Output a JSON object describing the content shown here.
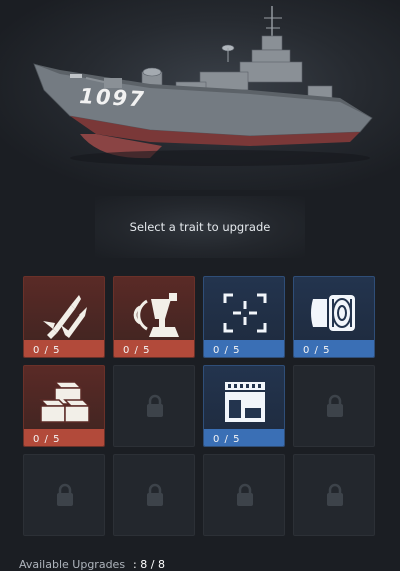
{
  "ship": {
    "hull_number": "1097"
  },
  "prompt": "Select a trait to upgrade",
  "traits": [
    {
      "name": "missile-upgrade",
      "state": "unlocked",
      "tone": "red",
      "progress": "0 / 5"
    },
    {
      "name": "radar-upgrade",
      "state": "unlocked",
      "tone": "red",
      "progress": "0 / 5"
    },
    {
      "name": "targeting-upgrade",
      "state": "unlocked",
      "tone": "blue",
      "progress": "0 / 5"
    },
    {
      "name": "engine-upgrade",
      "state": "unlocked",
      "tone": "blue",
      "progress": "0 / 5"
    },
    {
      "name": "supply-upgrade",
      "state": "unlocked",
      "tone": "red",
      "progress": "0 / 5"
    },
    {
      "name": "locked-slot",
      "state": "locked"
    },
    {
      "name": "hangar-upgrade",
      "state": "unlocked",
      "tone": "blue",
      "progress": "0 / 5"
    },
    {
      "name": "locked-slot",
      "state": "locked"
    },
    {
      "name": "locked-slot",
      "state": "locked"
    },
    {
      "name": "locked-slot",
      "state": "locked"
    },
    {
      "name": "locked-slot",
      "state": "locked"
    },
    {
      "name": "locked-slot",
      "state": "locked"
    }
  ],
  "footer": {
    "label": "Available Upgrades",
    "value": ": 8 / 8"
  },
  "colors": {
    "red": "#b24a3a",
    "blue": "#3a6fb5",
    "background": "#1b1e23"
  }
}
